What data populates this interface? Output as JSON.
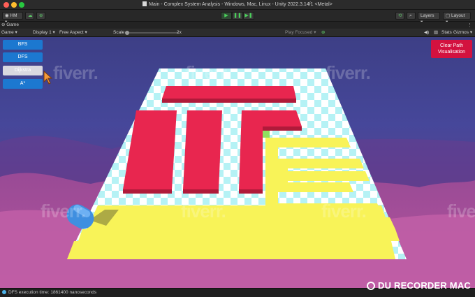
{
  "window": {
    "title": "Main - Complex System Analysis - Windows, Mac, Linux - Unity 2022.3.14f1 <Metal>",
    "traffic_colors": [
      "#ff5f57",
      "#febc2e",
      "#28c840"
    ]
  },
  "toolbar": {
    "account": "HM",
    "layers_label": "Layers",
    "layout_label": "Layout"
  },
  "tab": {
    "label": "Game"
  },
  "gamebar": {
    "display_mode": "Game",
    "display": "Display 1",
    "aspect": "Free Aspect",
    "scale_label": "Scale",
    "scale_value": "2x",
    "play_focused": "Play Focused",
    "stats": "Stats",
    "gizmos": "Gizmos"
  },
  "game_ui": {
    "buttons": [
      {
        "label": "BFS",
        "state": "normal"
      },
      {
        "label": "DFS",
        "state": "normal"
      },
      {
        "label": "Dijkstra",
        "state": "pressed"
      },
      {
        "label": "A*",
        "state": "normal"
      }
    ],
    "clear_button_line1": "Clear Path",
    "clear_button_line2": "Visualisation",
    "colors": {
      "button_blue": "#1c78d0",
      "clear_red": "#d3123f",
      "wall_red": "#e8264f",
      "path_yellow": "#f8f358",
      "tile_cyan": "#a9f0f4",
      "tile_white": "#ffffff"
    }
  },
  "watermark_text": "fiverr.",
  "status": {
    "message": "DFS execution time: 1861400 nanoseconds"
  },
  "recorder_overlay": "DU RECORDER MAC"
}
